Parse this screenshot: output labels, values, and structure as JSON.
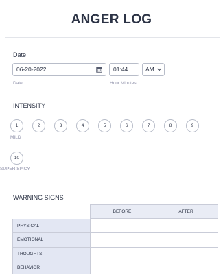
{
  "form": {
    "title": "ANGER LOG"
  },
  "date_section": {
    "label": "Date",
    "date_value": "06-20-2022",
    "date_sublabel": "Date",
    "time_value": "01:44",
    "ampm_value": "AM",
    "time_sublabel": "Hour Minutes"
  },
  "intensity": {
    "label": "INTENSITY",
    "options": [
      "1",
      "2",
      "3",
      "4",
      "5",
      "6",
      "7",
      "8",
      "9",
      "10"
    ],
    "min_caption": "MILD",
    "max_caption": "SUPER SPICY"
  },
  "warning_signs": {
    "label": "WARNING SIGNS",
    "columns": [
      "BEFORE",
      "AFTER"
    ],
    "rows": [
      "PHYSICAL",
      "EMOTIONAL",
      "THOUGHTS",
      "BEHAVIOR"
    ]
  },
  "icons": {
    "calendar": "calendar-icon",
    "dropdown": "chevron-down-icon"
  },
  "colors": {
    "text": "#2c3345",
    "border": "#b8bdc9",
    "muted": "#8d8fa8",
    "matrix_header": "#e9ecf5",
    "matrix_row_label": "#e3e7f3"
  }
}
